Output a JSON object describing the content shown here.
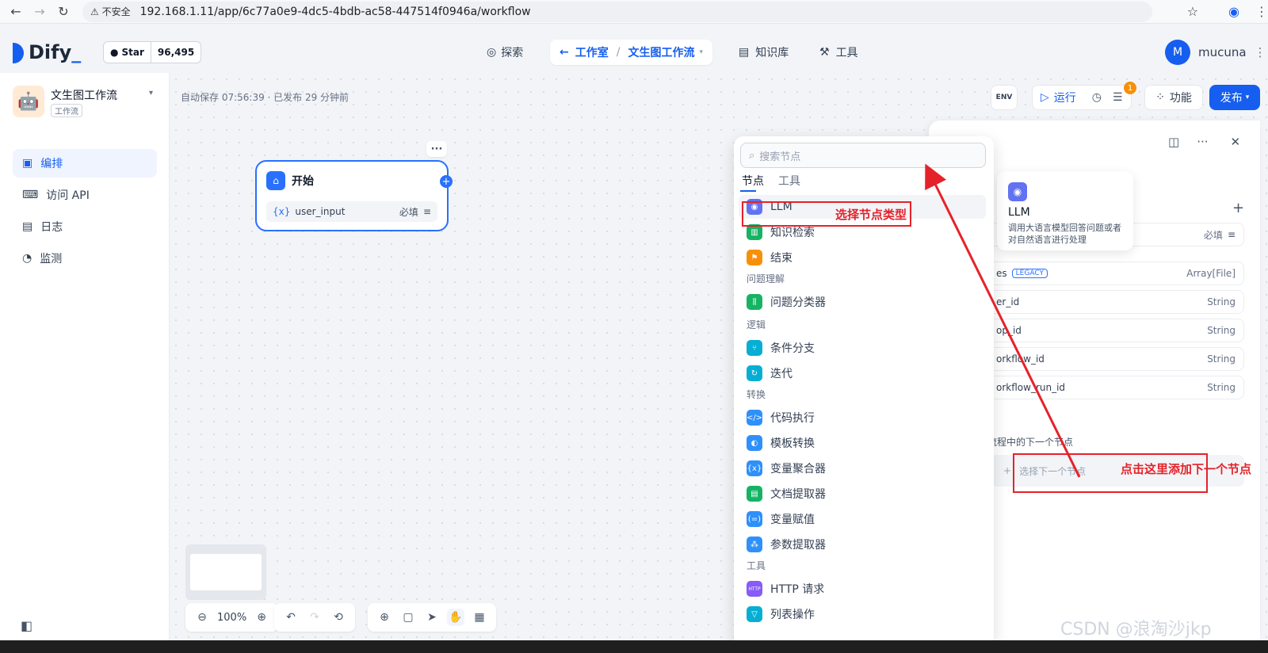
{
  "browser": {
    "security": "不安全",
    "url": "192.168.1.11/app/6c77a0e9-4dc5-4bdb-ac58-447514f0946a/workflow"
  },
  "header": {
    "logo": "Dify",
    "github_star": "Star",
    "github_count": "96,495",
    "nav": {
      "explore": "探索",
      "studio": "工作室",
      "current_app": "文生图工作流",
      "knowledge": "知识库",
      "tools": "工具"
    },
    "user": {
      "initial": "M",
      "name": "mucuna"
    }
  },
  "sidebar": {
    "app_name": "文生图工作流",
    "app_type": "工作流",
    "items": [
      {
        "label": "编排",
        "active": true
      },
      {
        "label": "访问 API",
        "active": false
      },
      {
        "label": "日志",
        "active": false
      },
      {
        "label": "监测",
        "active": false
      }
    ]
  },
  "canvas": {
    "autosave": "自动保存 07:56:39 · 已发布 29 分钟前",
    "start_node": {
      "title": "开始",
      "var_name": "user_input",
      "required": "必填"
    },
    "zoom": "100%"
  },
  "actions": {
    "env": "ENV",
    "run": "运行",
    "badge": "1",
    "features": "功能",
    "publish": "发布"
  },
  "right_panel": {
    "rows": [
      {
        "name": "",
        "type": "必填"
      },
      {
        "name": "es",
        "legacy": "LEGACY",
        "type": "Array[File]"
      },
      {
        "name": "er_id",
        "type": "String"
      },
      {
        "name": "op_id",
        "type": "String"
      },
      {
        "name": "orkflow_id",
        "type": "String"
      },
      {
        "name": "orkflow_run_id",
        "type": "String"
      }
    ],
    "next_label": "流程中的下一个节点",
    "next_placeholder": "选择下一个节点"
  },
  "tooltip": {
    "title": "LLM",
    "desc": "调用大语言模型回答问题或者对自然语言进行处理"
  },
  "node_selector": {
    "search_placeholder": "搜索节点",
    "tabs": [
      "节点",
      "工具"
    ],
    "groups": [
      {
        "category": "",
        "items": [
          {
            "label": "LLM",
            "color": "#6172f3",
            "icon": "llm-icon"
          },
          {
            "label": "知识检索",
            "color": "#16b364",
            "icon": "knowledge-icon"
          },
          {
            "label": "结束",
            "color": "#f79009",
            "icon": "end-icon"
          }
        ]
      },
      {
        "category": "问题理解",
        "items": [
          {
            "label": "问题分类器",
            "color": "#16b364",
            "icon": "classifier-icon"
          }
        ]
      },
      {
        "category": "逻辑",
        "items": [
          {
            "label": "条件分支",
            "color": "#06aed4",
            "icon": "branch-icon"
          },
          {
            "label": "迭代",
            "color": "#06aed4",
            "icon": "iteration-icon"
          }
        ]
      },
      {
        "category": "转换",
        "items": [
          {
            "label": "代码执行",
            "color": "#2e90fa",
            "icon": "code-icon"
          },
          {
            "label": "模板转换",
            "color": "#2e90fa",
            "icon": "template-icon"
          },
          {
            "label": "变量聚合器",
            "color": "#2e90fa",
            "icon": "aggregator-icon"
          },
          {
            "label": "文档提取器",
            "color": "#16b364",
            "icon": "doc-extractor-icon"
          },
          {
            "label": "变量赋值",
            "color": "#2e90fa",
            "icon": "assign-icon"
          },
          {
            "label": "参数提取器",
            "color": "#2e90fa",
            "icon": "param-icon"
          }
        ]
      },
      {
        "category": "工具",
        "items": [
          {
            "label": "HTTP 请求",
            "color": "#875bf7",
            "icon": "http-icon"
          },
          {
            "label": "列表操作",
            "color": "#06aed4",
            "icon": "list-icon"
          }
        ]
      }
    ]
  },
  "annotations": {
    "select_type": "选择节点类型",
    "click_here": "点击这里添加下一个节点"
  },
  "watermark": "CSDN @浪淘沙jkp"
}
